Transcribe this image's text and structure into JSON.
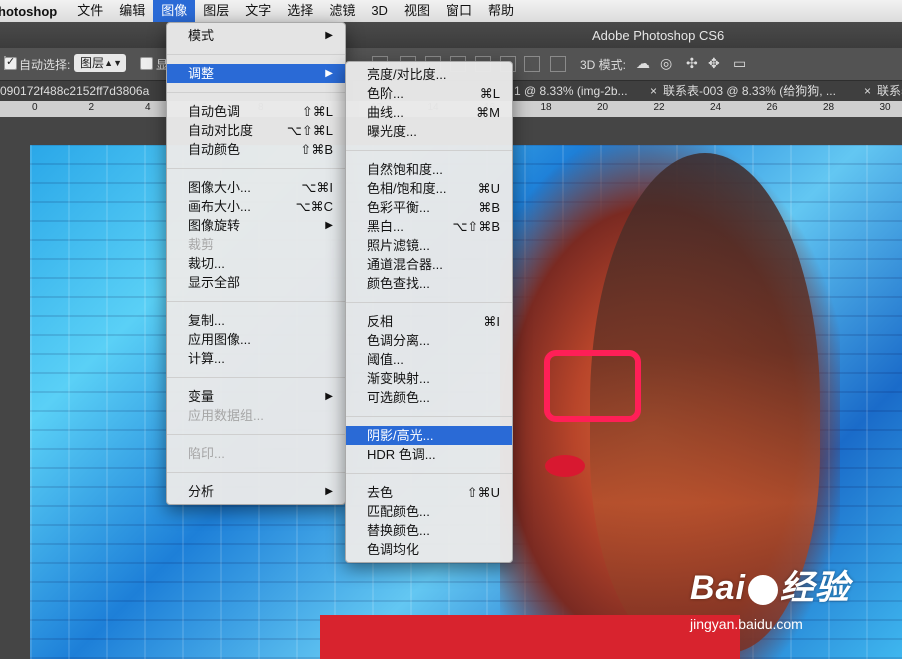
{
  "menubar": {
    "app_name": "hotoshop",
    "items": [
      "文件",
      "编辑",
      "图像",
      "图层",
      "文字",
      "选择",
      "滤镜",
      "3D",
      "视图",
      "窗口",
      "帮助"
    ],
    "active_index": 2
  },
  "window": {
    "title": "Adobe Photoshop CS6"
  },
  "options_bar": {
    "auto_select_label": "自动选择:",
    "auto_select_value": "图层",
    "show_label": "显",
    "mode_3d_label": "3D 模式:"
  },
  "tabs": [
    {
      "label": "090172f488c2152ff7d3806a"
    },
    {
      "label": "1 @ 8.33% (img-2b..."
    },
    {
      "close": "×",
      "label": "联系表-003 @ 8.33% (给狗狗, ..."
    },
    {
      "close": "×",
      "label": "联系表"
    }
  ],
  "ruler": {
    "ticks": [
      "0",
      "2",
      "4",
      "6",
      "8",
      "10",
      "12",
      "14",
      "16",
      "18",
      "20",
      "22",
      "24",
      "26",
      "28",
      "30"
    ]
  },
  "image_menu": {
    "items": [
      {
        "label": "模式",
        "submenu": true
      },
      {
        "sep": true
      },
      {
        "label": "调整",
        "submenu": true,
        "highlighted": true
      },
      {
        "sep": true
      },
      {
        "label": "自动色调",
        "shortcut": "⇧⌘L"
      },
      {
        "label": "自动对比度",
        "shortcut": "⌥⇧⌘L"
      },
      {
        "label": "自动颜色",
        "shortcut": "⇧⌘B"
      },
      {
        "sep": true
      },
      {
        "label": "图像大小...",
        "shortcut": "⌥⌘I"
      },
      {
        "label": "画布大小...",
        "shortcut": "⌥⌘C"
      },
      {
        "label": "图像旋转",
        "submenu": true
      },
      {
        "label": "裁剪",
        "disabled": true
      },
      {
        "label": "裁切..."
      },
      {
        "label": "显示全部"
      },
      {
        "sep": true
      },
      {
        "label": "复制..."
      },
      {
        "label": "应用图像..."
      },
      {
        "label": "计算..."
      },
      {
        "sep": true
      },
      {
        "label": "变量",
        "submenu": true
      },
      {
        "label": "应用数据组...",
        "disabled": true
      },
      {
        "sep": true
      },
      {
        "label": "陷印...",
        "disabled": true
      },
      {
        "sep": true
      },
      {
        "label": "分析",
        "submenu": true
      }
    ]
  },
  "adjust_menu": {
    "items": [
      {
        "label": "亮度/对比度..."
      },
      {
        "label": "色阶...",
        "shortcut": "⌘L"
      },
      {
        "label": "曲线...",
        "shortcut": "⌘M"
      },
      {
        "label": "曝光度..."
      },
      {
        "sep": true
      },
      {
        "label": "自然饱和度..."
      },
      {
        "label": "色相/饱和度...",
        "shortcut": "⌘U"
      },
      {
        "label": "色彩平衡...",
        "shortcut": "⌘B"
      },
      {
        "label": "黑白...",
        "shortcut": "⌥⇧⌘B"
      },
      {
        "label": "照片滤镜..."
      },
      {
        "label": "通道混合器..."
      },
      {
        "label": "颜色查找..."
      },
      {
        "sep": true
      },
      {
        "label": "反相",
        "shortcut": "⌘I"
      },
      {
        "label": "色调分离..."
      },
      {
        "label": "阈值..."
      },
      {
        "label": "渐变映射..."
      },
      {
        "label": "可选颜色..."
      },
      {
        "sep": true
      },
      {
        "label": "阴影/高光...",
        "highlighted": true
      },
      {
        "label": "HDR 色调..."
      },
      {
        "sep": true
      },
      {
        "label": "去色",
        "shortcut": "⇧⌘U"
      },
      {
        "label": "匹配颜色..."
      },
      {
        "label": "替换颜色..."
      },
      {
        "label": "色调均化"
      }
    ]
  },
  "watermark": {
    "logo": "Bai 经验",
    "logo_left": "Bai",
    "logo_right": "经验",
    "url": "jingyan.baidu.com"
  },
  "colors": {
    "highlight": "#2a6ad6",
    "menu_bg": "#e9e9e9",
    "canvas_blue": "#2aa7e8"
  }
}
